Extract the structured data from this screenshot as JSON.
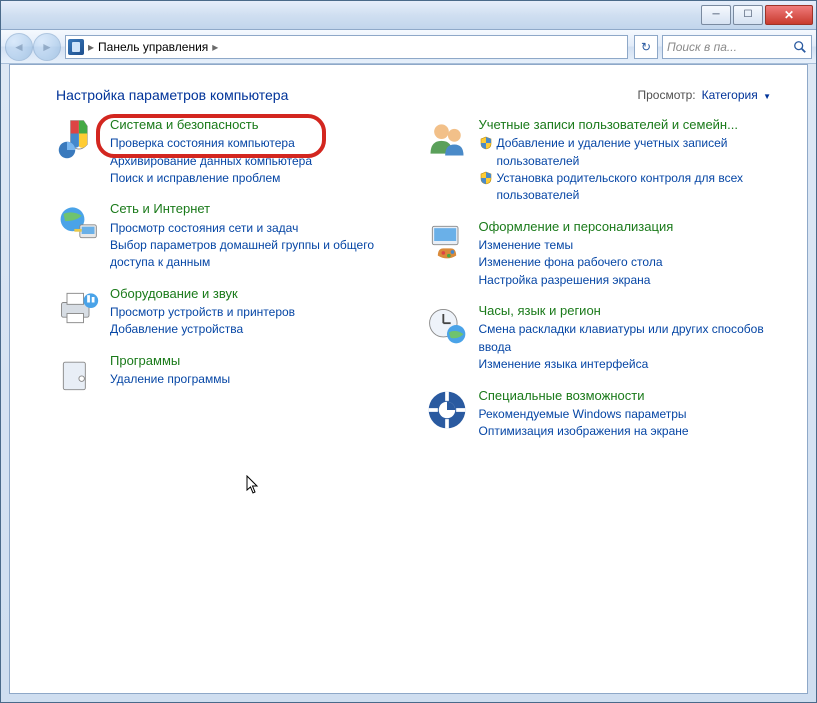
{
  "titlebar": {
    "minimize_glyph": "─",
    "maximize_glyph": "☐",
    "close_glyph": "✕"
  },
  "navbar": {
    "back_glyph": "◄",
    "forward_glyph": "►",
    "addr_sep1": "▸",
    "addr_text": "Панель управления",
    "addr_sep2": "▸",
    "refresh_glyph": "↻",
    "search_placeholder": "Поиск в па..."
  },
  "header": {
    "title": "Настройка параметров компьютера",
    "view_label": "Просмотр:",
    "view_value": "Категория"
  },
  "left": [
    {
      "title": "Система и безопасность",
      "icon": "shield-pie",
      "tasks": [
        {
          "text": "Проверка состояния компьютера"
        },
        {
          "text": "Архивирование данных компьютера"
        },
        {
          "text": "Поиск и исправление проблем"
        }
      ]
    },
    {
      "title": "Сеть и Интернет",
      "icon": "globe-net",
      "tasks": [
        {
          "text": "Просмотр состояния сети и задач"
        },
        {
          "text": "Выбор параметров домашней группы и общего доступа к данным"
        }
      ]
    },
    {
      "title": "Оборудование и звук",
      "icon": "printer",
      "tasks": [
        {
          "text": "Просмотр устройств и принтеров"
        },
        {
          "text": "Добавление устройства"
        }
      ]
    },
    {
      "title": "Программы",
      "icon": "disc-box",
      "tasks": [
        {
          "text": "Удаление программы"
        }
      ]
    }
  ],
  "right": [
    {
      "title": "Учетные записи пользователей и семейн...",
      "icon": "users",
      "tasks": [
        {
          "text": "Добавление и удаление учетных записей пользователей",
          "shield": true
        },
        {
          "text": "Установка родительского контроля для всех пользователей",
          "shield": true
        }
      ]
    },
    {
      "title": "Оформление и персонализация",
      "icon": "palette",
      "tasks": [
        {
          "text": "Изменение темы"
        },
        {
          "text": "Изменение фона рабочего стола"
        },
        {
          "text": "Настройка разрешения экрана"
        }
      ]
    },
    {
      "title": "Часы, язык и регион",
      "icon": "clock-globe",
      "tasks": [
        {
          "text": "Смена раскладки клавиатуры или других способов ввода"
        },
        {
          "text": "Изменение языка интерфейса"
        }
      ]
    },
    {
      "title": "Специальные возможности",
      "icon": "ease",
      "tasks": [
        {
          "text": "Рекомендуемые Windows параметры"
        },
        {
          "text": "Оптимизация изображения на экране"
        }
      ]
    }
  ]
}
